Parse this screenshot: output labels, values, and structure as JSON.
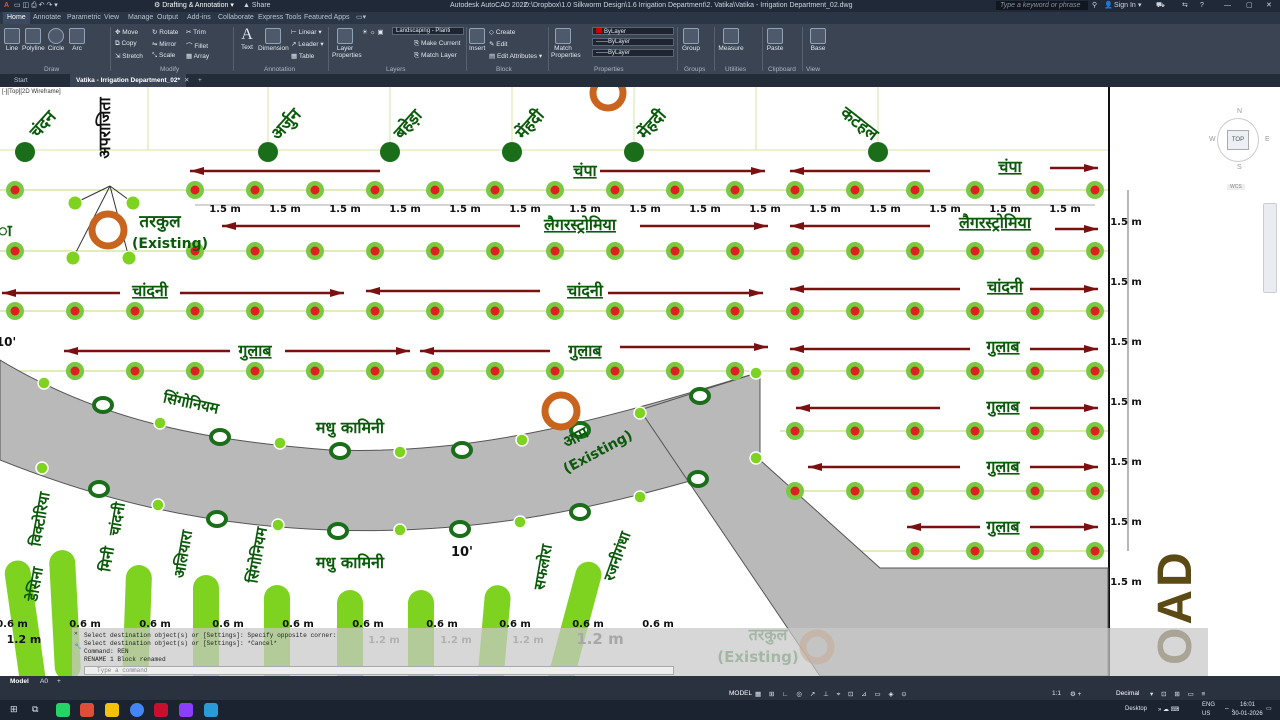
{
  "window": {
    "title": "Autodesk AutoCAD 2022",
    "path": "D:\\Dropbox\\1.0 Silkworm Design\\1.6 Irrigation Department\\2. Vatika\\Vatika - Irrigation Department_02.dwg",
    "workspace": "Drafting & Annotation",
    "share": "Share",
    "search_placeholder": "Type a keyword or phrase",
    "sign_in": "Sign In"
  },
  "ribbon_tabs": [
    "Home",
    "Annotate",
    "Parametric",
    "View",
    "Manage",
    "Output",
    "Add-ins",
    "Collaborate",
    "Express Tools",
    "Featured Apps"
  ],
  "ribbon": {
    "draw": {
      "items": [
        "Line",
        "Polyline",
        "Circle",
        "Arc"
      ],
      "panel": "Draw"
    },
    "modify": {
      "items": [
        "Move",
        "Rotate",
        "Trim",
        "Copy",
        "Mirror",
        "Fillet",
        "Stretch",
        "Scale",
        "Array"
      ],
      "panel": "Modify"
    },
    "annotation": {
      "items": [
        "Text",
        "Dimension",
        "Linear",
        "Leader",
        "Table"
      ],
      "panel": "Annotation"
    },
    "layers": {
      "items": [
        "Layer Properties",
        "Make Current",
        "Match Layer"
      ],
      "current_layer": "Landscaping - Planti",
      "panel": "Layers"
    },
    "block": {
      "items": [
        "Insert",
        "Create",
        "Edit",
        "Edit Attributes"
      ],
      "panel": "Block"
    },
    "properties": {
      "items": [
        "Match Properties"
      ],
      "values": [
        "ByLayer",
        "ByLayer",
        "ByLayer"
      ],
      "panel": "Properties"
    },
    "groups": {
      "items": [
        "Group"
      ],
      "panel": "Groups"
    },
    "utilities": {
      "items": [
        "Measure"
      ],
      "panel": "Utilities"
    },
    "clipboard": {
      "items": [
        "Paste"
      ],
      "panel": "Clipboard"
    },
    "view": {
      "items": [
        "Base"
      ],
      "panel": "View"
    }
  },
  "file_tabs": [
    "Start",
    "Vatika - Irrigation Department_02*"
  ],
  "viewport_label": "[-][Top][2D Wireframe]",
  "viewcube": {
    "top": "TOP",
    "n": "N",
    "s": "S",
    "e": "E",
    "w": "W",
    "wcs": "WCS"
  },
  "drawing": {
    "top_trees": [
      "चंदन",
      "अर्जुन",
      "बहेड़ा",
      "मेंहदी",
      "मेंहदी",
      "कटहल"
    ],
    "tree_label": "अपराजिता",
    "row_labels": {
      "r1": "चंपा",
      "r2": "लैगरस्ट्रोमिया",
      "r3": "चांदनी",
      "r4": "गुलाब",
      "left_cut": "ा"
    },
    "spacing": "1.5 m",
    "existing": "(Existing)",
    "tarkul": "तरकुल",
    "aam": "आम",
    "path_labels": [
      "सिंगोनियम",
      "मधु कामिनी",
      "मधु कामिनी",
      "सिंगोनियम"
    ],
    "bed_labels": [
      "डेसिना",
      "विक्टोरिया",
      "मिनी",
      "चांदनी",
      "अलियारा",
      "सफलोरा",
      "रजनीगंधा"
    ],
    "bed_spacing": "0.6 m",
    "bed_row": "1.2 m",
    "dim_angle": "10'",
    "dim_left": "10'",
    "road": "OAD"
  },
  "command": {
    "lines": [
      "Select destination object(s) or [Settings]: Specify opposite corner:",
      "Select destination object(s) or [Settings]: *Cancel*",
      "Command: REN",
      "RENAME 1 Block renamed"
    ],
    "placeholder": "Type a command"
  },
  "status": {
    "tabs": [
      "Model",
      "A0"
    ],
    "model": "MODEL",
    "scale": "1:1",
    "units": "Decimal"
  },
  "taskbar": {
    "desktop": "Desktop",
    "lang": "ENG",
    "region": "US",
    "time": "16:01",
    "date": "30-01-2026"
  },
  "colors": {
    "row_line": "#d7e6a8",
    "arrow": "#7a1010",
    "plant_ring": "#7ac943",
    "plant_core": "#e02020",
    "tree": "#1a6e1a",
    "existing": "#c8641e",
    "paving": "#b9b9b9",
    "bed": "#7ed321",
    "text": "#0a5a0a"
  }
}
